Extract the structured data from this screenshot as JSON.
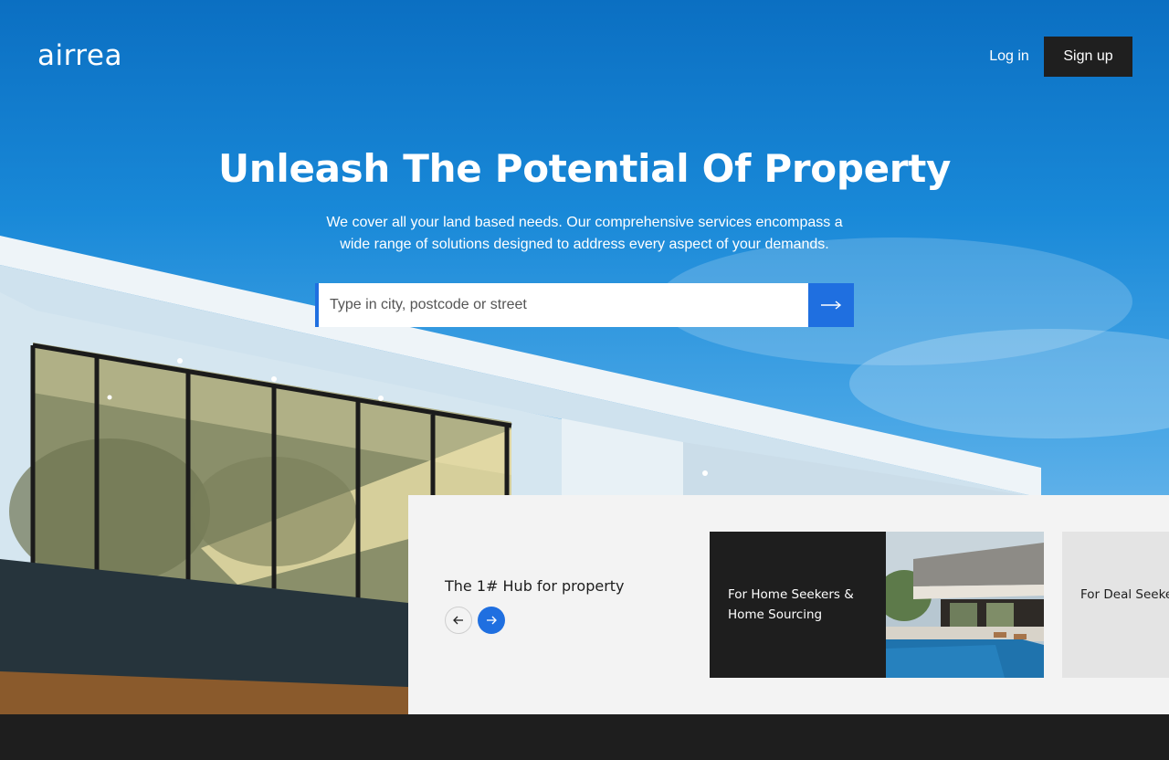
{
  "header": {
    "logo": "airrea",
    "login_label": "Log in",
    "signup_label": "Sign up"
  },
  "hero": {
    "headline": "Unleash The Potential Of Property",
    "subtext": "We cover all your land based needs. Our comprehensive services encompass a wide range of solutions designed to address every aspect of your demands."
  },
  "search": {
    "placeholder": "Type in city, postcode or street",
    "value": "",
    "button_icon": "arrow-right-icon"
  },
  "hub": {
    "title": "The 1# Hub for property",
    "prev_icon": "arrow-left-icon",
    "next_icon": "arrow-right-icon",
    "cards": [
      {
        "label": "For Home Seekers & Home Sourcing",
        "image": "villa-with-pool-photo"
      },
      {
        "label": "For Deal Seekers & Deal Sourcing"
      }
    ]
  },
  "colors": {
    "accent": "#1f6fe0",
    "dark": "#1e1e1e",
    "panel": "#f3f3f3"
  }
}
